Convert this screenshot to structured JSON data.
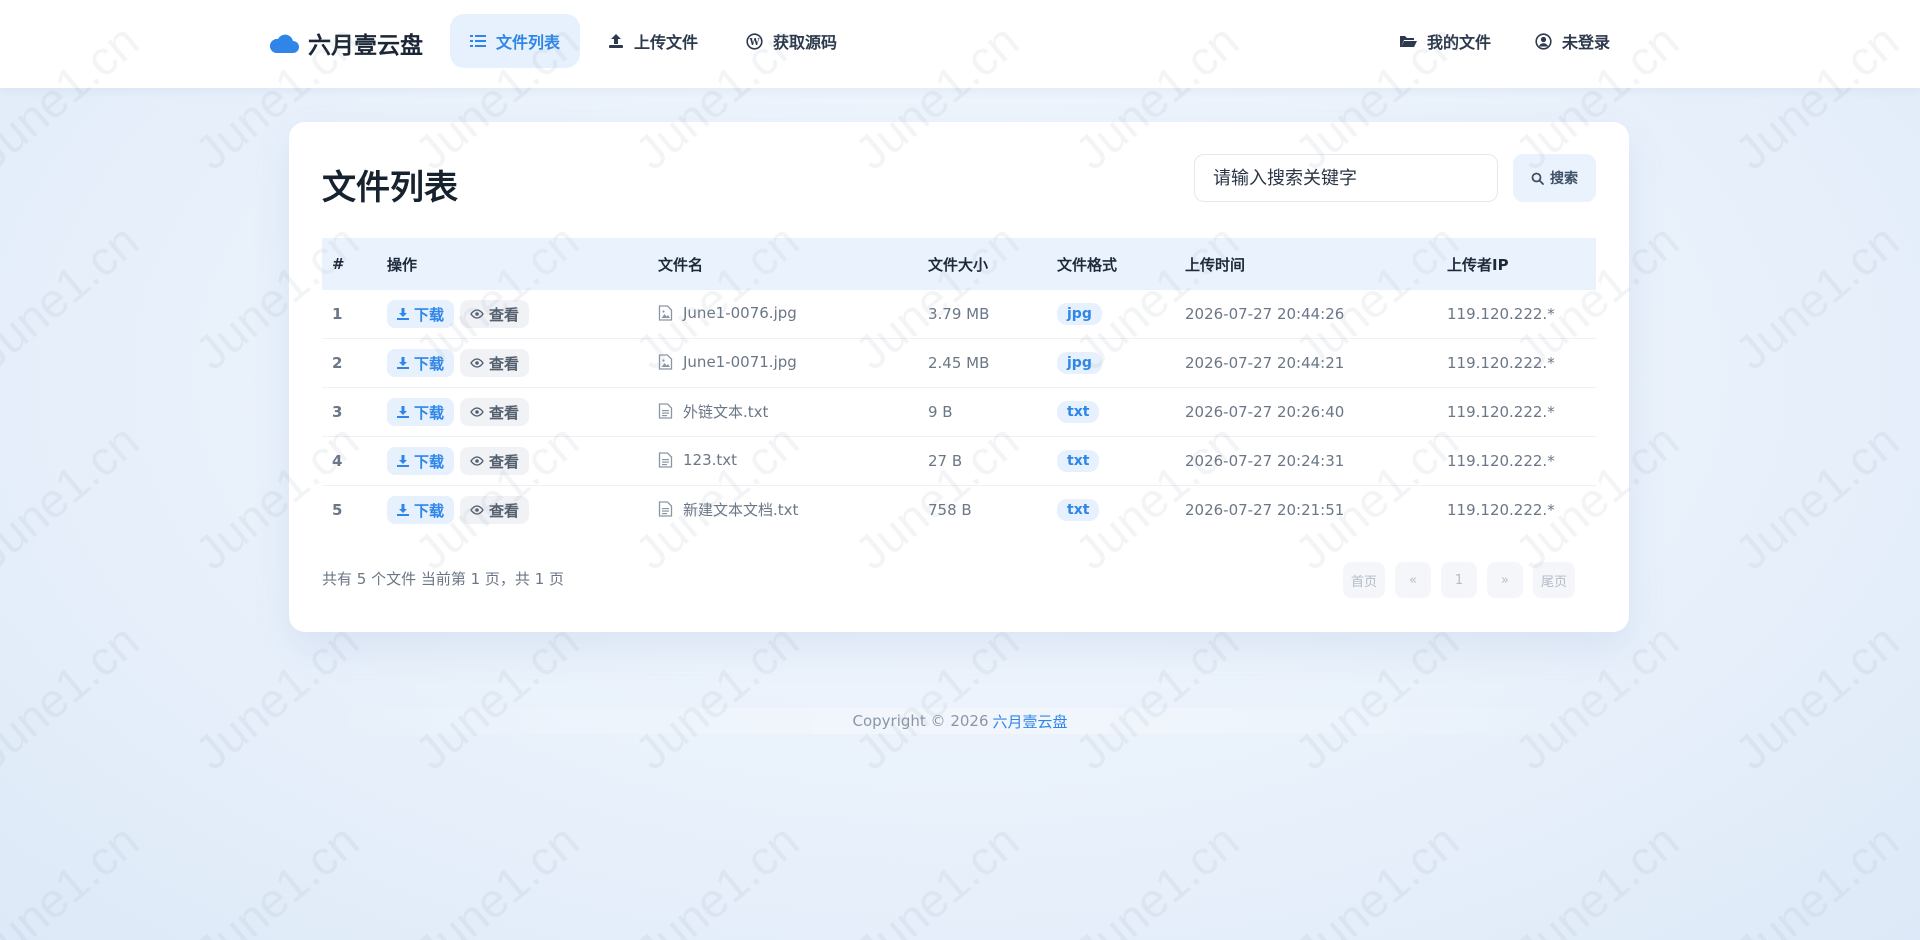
{
  "brand": {
    "name": "六月壹云盘"
  },
  "nav": {
    "left": [
      {
        "label": "文件列表",
        "icon": "list-icon",
        "active": true
      },
      {
        "label": "上传文件",
        "icon": "upload-icon",
        "active": false
      },
      {
        "label": "获取源码",
        "icon": "wordpress-icon",
        "active": false
      }
    ],
    "right": [
      {
        "label": "我的文件",
        "icon": "folder-open-icon"
      },
      {
        "label": "未登录",
        "icon": "user-circle-icon"
      }
    ]
  },
  "card": {
    "title": "文件列表",
    "search": {
      "placeholder": "请输入搜索关键字",
      "value": "",
      "button_label": "搜索"
    }
  },
  "table": {
    "columns": [
      "#",
      "操作",
      "文件名",
      "文件大小",
      "文件格式",
      "上传时间",
      "上传者IP"
    ],
    "actions": {
      "download": "下载",
      "view": "查看"
    },
    "rows": [
      {
        "index": "1",
        "name": "June1-0076.jpg",
        "size": "3.79 MB",
        "format": "jpg",
        "time": "2026-07-27 20:44:26",
        "ip": "119.120.222.*",
        "icon": "image-file-icon"
      },
      {
        "index": "2",
        "name": "June1-0071.jpg",
        "size": "2.45 MB",
        "format": "jpg",
        "time": "2026-07-27 20:44:21",
        "ip": "119.120.222.*",
        "icon": "image-file-icon"
      },
      {
        "index": "3",
        "name": "外链文本.txt",
        "size": "9 B",
        "format": "txt",
        "time": "2026-07-27 20:26:40",
        "ip": "119.120.222.*",
        "icon": "text-file-icon"
      },
      {
        "index": "4",
        "name": "123.txt",
        "size": "27 B",
        "format": "txt",
        "time": "2026-07-27 20:24:31",
        "ip": "119.120.222.*",
        "icon": "text-file-icon"
      },
      {
        "index": "5",
        "name": "新建文本文档.txt",
        "size": "758 B",
        "format": "txt",
        "time": "2026-07-27 20:21:51",
        "ip": "119.120.222.*",
        "icon": "text-file-icon"
      }
    ]
  },
  "summary": "共有 5 个文件  当前第 1 页，共 1 页",
  "pagination": {
    "first": "首页",
    "prev": "«",
    "current": "1",
    "next": "»",
    "last": "尾页"
  },
  "footer": {
    "copyright": "Copyright © 2026",
    "link": "六月壹云盘"
  },
  "watermark": {
    "text": "June1.cn"
  },
  "colors": {
    "accent": "#2f86e8",
    "accent_bg": "#e6f1fd",
    "text_dark": "#1e2a3b",
    "text_muted": "#6b7787"
  }
}
